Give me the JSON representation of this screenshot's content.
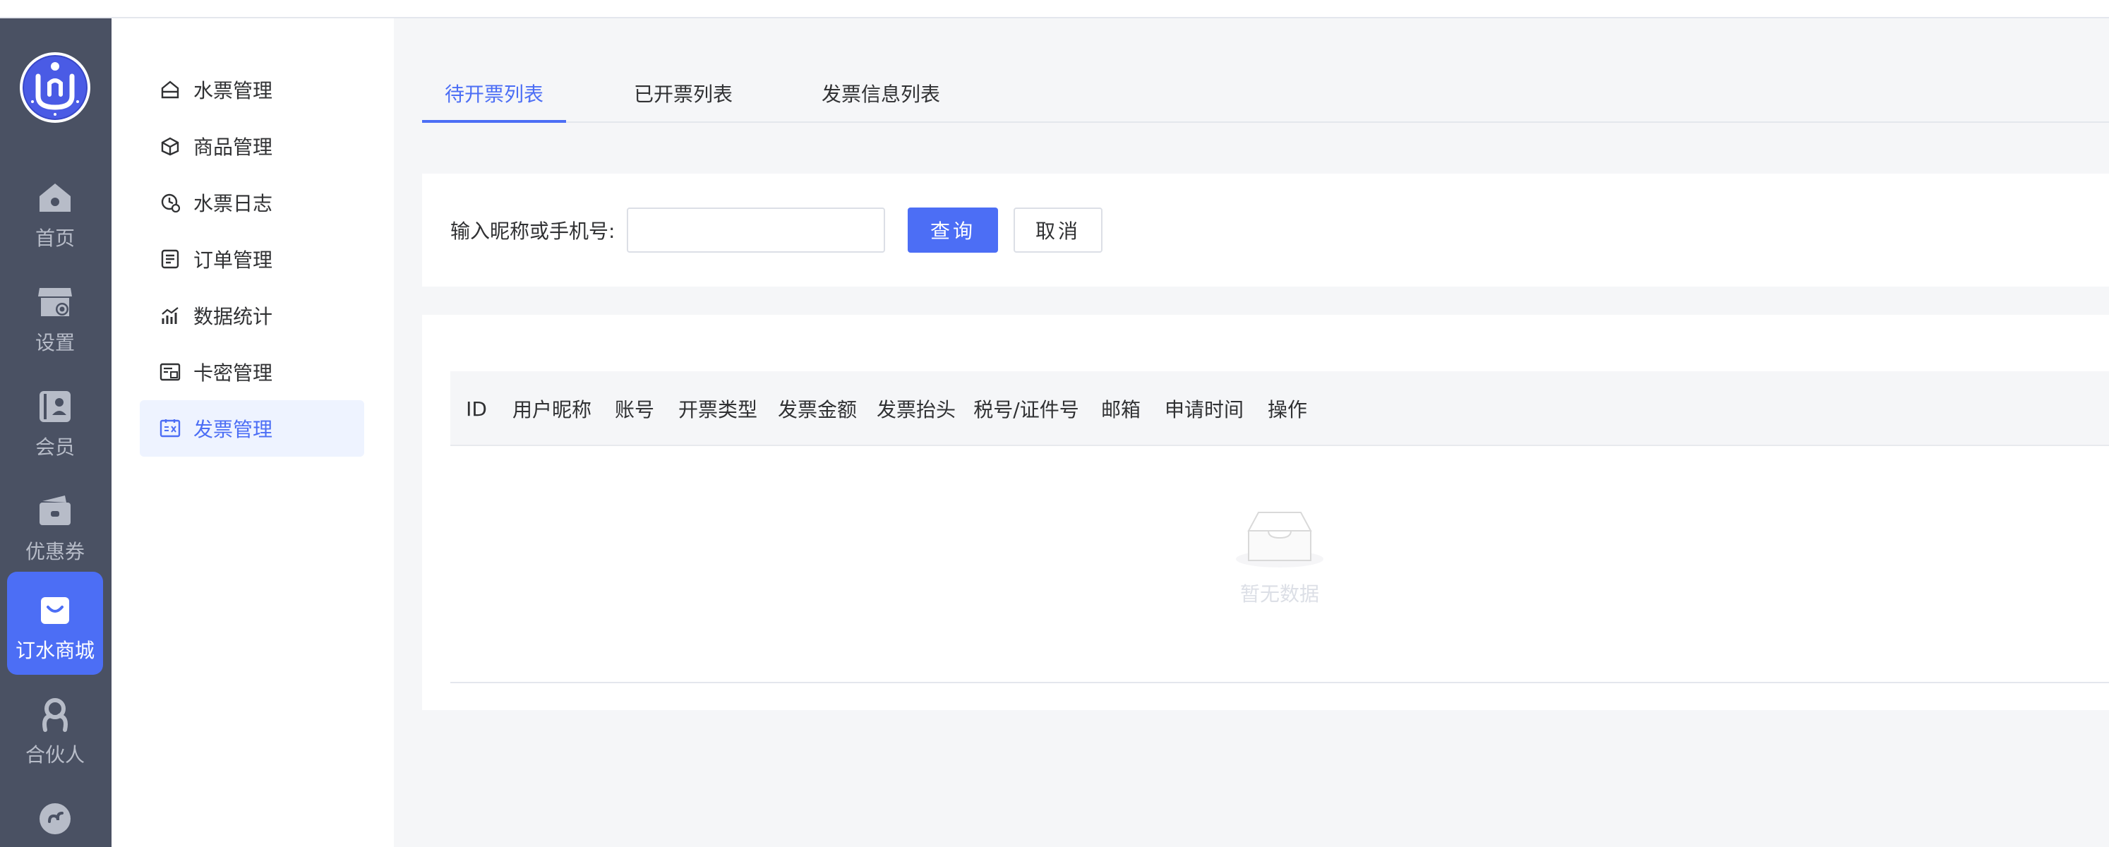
{
  "nav": {
    "items": [
      {
        "label": "首页",
        "icon": "home-icon",
        "active": false
      },
      {
        "label": "设置",
        "icon": "store-settings-icon",
        "active": false
      },
      {
        "label": "会员",
        "icon": "member-icon",
        "active": false
      },
      {
        "label": "优惠券",
        "icon": "wallet-icon",
        "active": false
      },
      {
        "label": "订水商城",
        "icon": "shopping-bag-icon",
        "active": true
      },
      {
        "label": "合伙人",
        "icon": "partner-icon",
        "active": false
      },
      {
        "label": "",
        "icon": "mini-program-icon",
        "active": false
      }
    ]
  },
  "subnav": {
    "items": [
      {
        "label": "水票管理",
        "icon": "ticket-icon"
      },
      {
        "label": "商品管理",
        "icon": "cube-icon"
      },
      {
        "label": "水票日志",
        "icon": "clock-log-icon"
      },
      {
        "label": "订单管理",
        "icon": "document-icon"
      },
      {
        "label": "数据统计",
        "icon": "chart-icon"
      },
      {
        "label": "卡密管理",
        "icon": "card-icon"
      },
      {
        "label": "发票管理",
        "icon": "invoice-icon",
        "active": true
      }
    ]
  },
  "tabs": [
    {
      "label": "待开票列表",
      "active": true
    },
    {
      "label": "已开票列表",
      "active": false
    },
    {
      "label": "发票信息列表",
      "active": false
    }
  ],
  "search": {
    "label": "输入昵称或手机号:",
    "value": "",
    "placeholder": "",
    "query_button": "查询",
    "cancel_button": "取消"
  },
  "table": {
    "columns": [
      "ID",
      "用户昵称",
      "账号",
      "开票类型",
      "发票金额",
      "发票抬头",
      "税号/证件号",
      "邮箱",
      "申请时间",
      "操作"
    ],
    "rows": [],
    "empty_text": "暂无数据"
  },
  "colors": {
    "accent": "#4c6ef5",
    "nav_bg": "#4a5163",
    "page_bg": "#f5f6f8"
  }
}
